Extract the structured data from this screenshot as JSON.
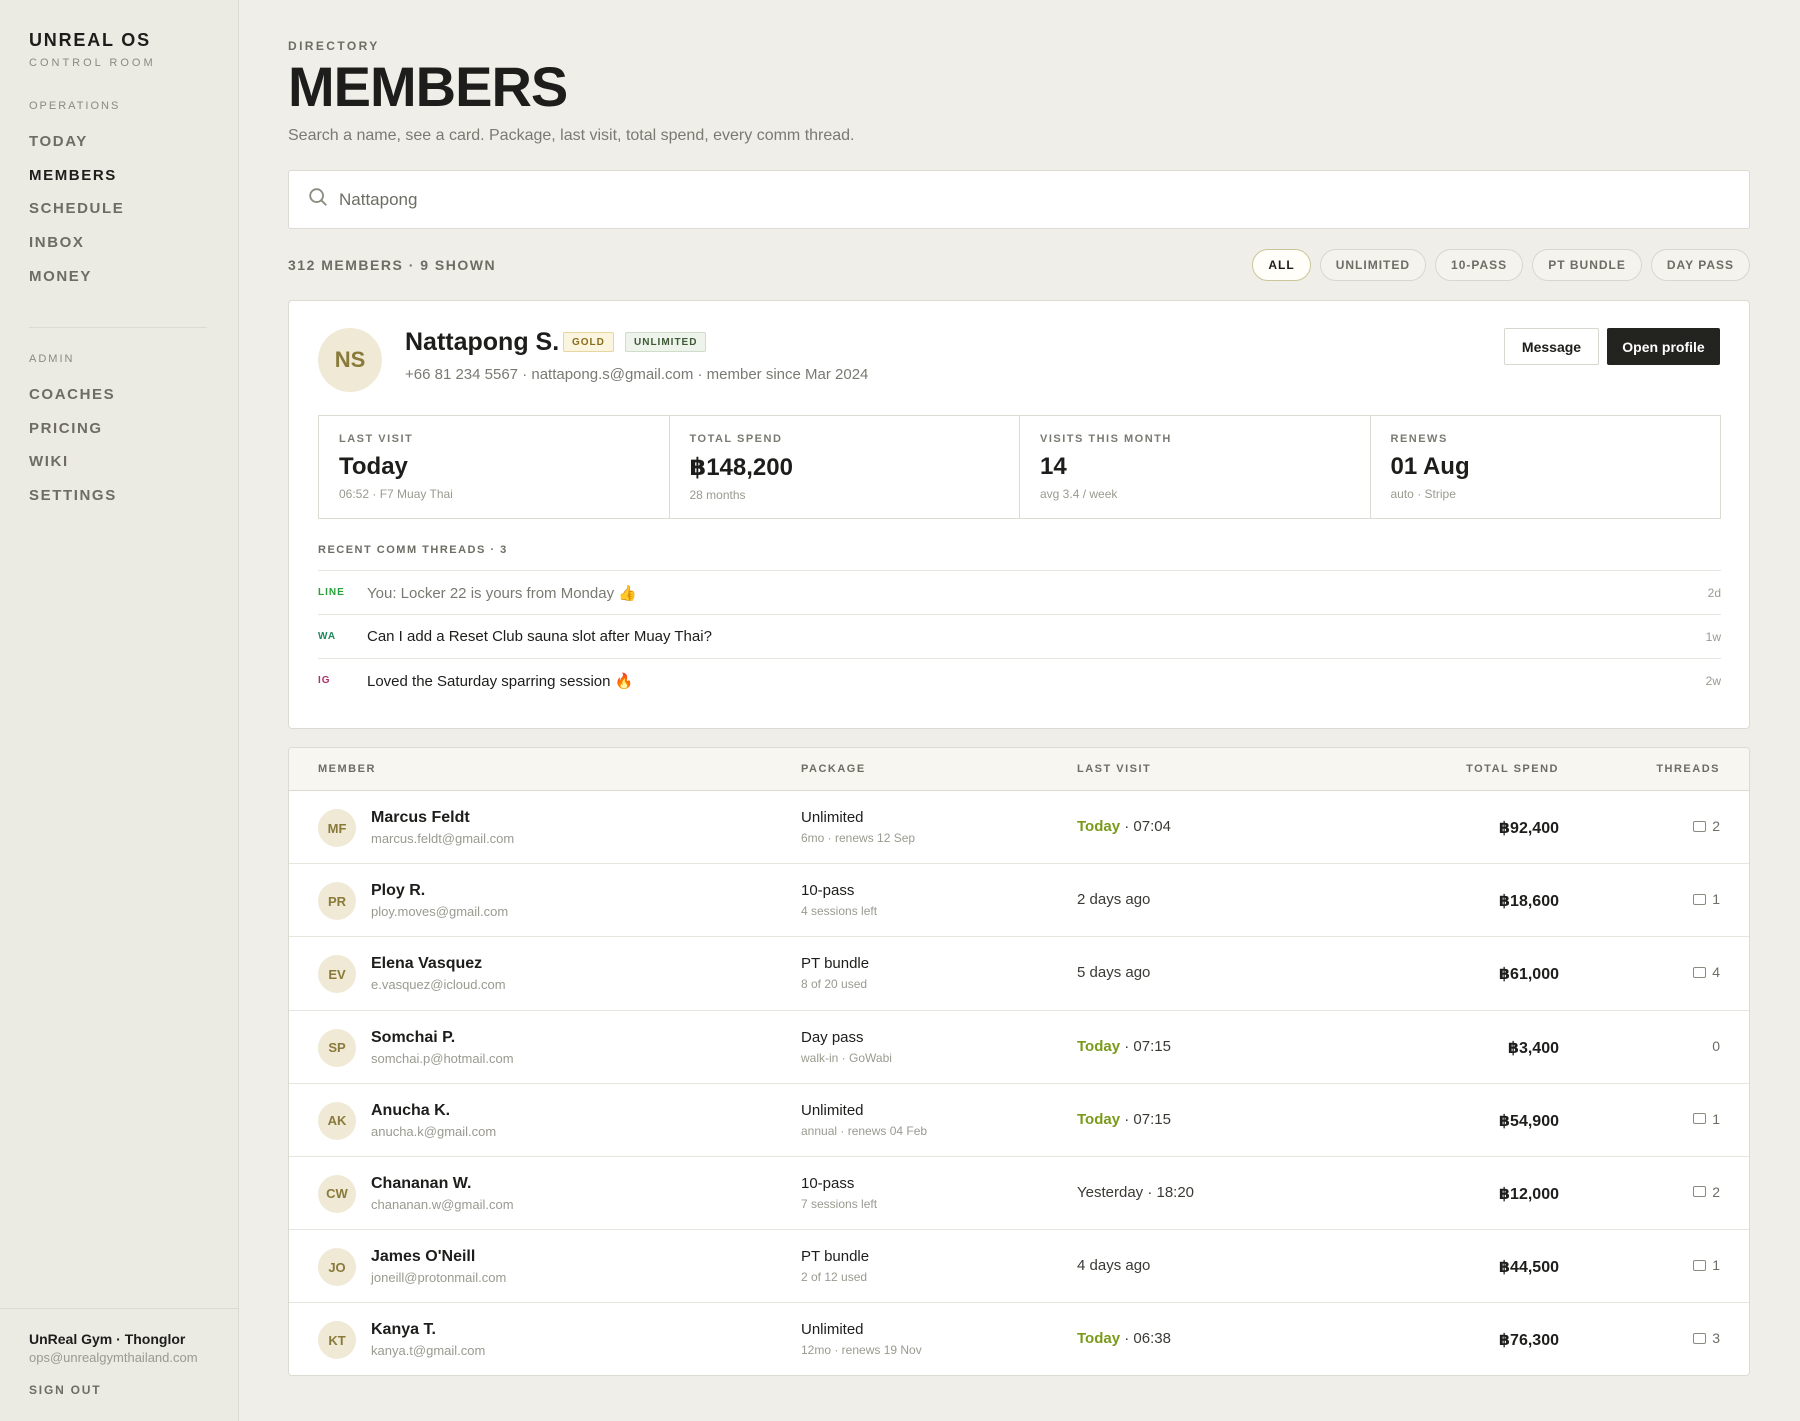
{
  "sidebar": {
    "brand": "UNREAL OS",
    "brand_sub": "CONTROL ROOM",
    "operations_heading": "OPERATIONS",
    "operations": [
      "TODAY",
      "MEMBERS",
      "SCHEDULE",
      "INBOX",
      "MONEY"
    ],
    "admin_heading": "ADMIN",
    "admin": [
      "COACHES",
      "PRICING",
      "WIKI",
      "SETTINGS"
    ],
    "footer": {
      "gym": "UnReal Gym · Thonglor",
      "email": "ops@unrealgymthailand.com",
      "sign_out": "SIGN OUT"
    }
  },
  "header": {
    "eyebrow": "DIRECTORY",
    "title": "MEMBERS",
    "subtitle": "Search a name, see a card. Package, last visit, total spend, every comm thread."
  },
  "search": {
    "value": "Nattapong",
    "placeholder": ""
  },
  "count": "312 MEMBERS · 9 SHOWN",
  "filters": [
    "ALL",
    "UNLIMITED",
    "10-PASS",
    "PT BUNDLE",
    "DAY PASS"
  ],
  "profile": {
    "initials": "NS",
    "name": "Nattapong S.",
    "badge_gold": "GOLD",
    "badge_package": "UNLIMITED",
    "meta": "+66 81 234 5567 · nattapong.s@gmail.com · member since Mar 2024",
    "message_label": "Message",
    "open_label": "Open profile",
    "stats": [
      {
        "label": "LAST VISIT",
        "value": "Today",
        "sub": "06:52 · F7 Muay Thai"
      },
      {
        "label": "TOTAL SPEND",
        "value": "฿148,200",
        "sub": "28 months"
      },
      {
        "label": "VISITS THIS MONTH",
        "value": "14",
        "sub": "avg 3.4 / week"
      },
      {
        "label": "RENEWS",
        "value": "01 Aug",
        "sub": "auto · Stripe"
      }
    ],
    "threads_heading": "RECENT COMM THREADS · 3",
    "threads": [
      {
        "channel": "LINE",
        "text": "You: Locker 22 is yours from Monday 👍",
        "time": "2d"
      },
      {
        "channel": "WA",
        "text": "Can I add a Reset Club sauna slot after Muay Thai?",
        "time": "1w"
      },
      {
        "channel": "IG",
        "text": "Loved the Saturday sparring session 🔥",
        "time": "2w"
      }
    ]
  },
  "table": {
    "columns": {
      "member": "MEMBER",
      "package": "PACKAGE",
      "last_visit": "LAST VISIT",
      "total_spend": "TOTAL SPEND",
      "threads": "THREADS"
    },
    "rows": [
      {
        "initials": "MF",
        "name": "Marcus Feldt",
        "email": "marcus.feldt@gmail.com",
        "package": "Unlimited",
        "package_sub": "6mo · renews 12 Sep",
        "visit_today": "Today",
        "visit": " · 07:04",
        "spend": "฿92,400",
        "threads": "2"
      },
      {
        "initials": "PR",
        "name": "Ploy R.",
        "email": "ploy.moves@gmail.com",
        "package": "10-pass",
        "package_sub": "4 sessions left",
        "visit_today": "",
        "visit": "2 days ago",
        "spend": "฿18,600",
        "threads": "1"
      },
      {
        "initials": "EV",
        "name": "Elena Vasquez",
        "email": "e.vasquez@icloud.com",
        "package": "PT bundle",
        "package_sub": "8 of 20 used",
        "visit_today": "",
        "visit": "5 days ago",
        "spend": "฿61,000",
        "threads": "4"
      },
      {
        "initials": "SP",
        "name": "Somchai P.",
        "email": "somchai.p@hotmail.com",
        "package": "Day pass",
        "package_sub": "walk-in · GoWabi",
        "visit_today": "Today",
        "visit": " · 07:15",
        "spend": "฿3,400",
        "threads": "0"
      },
      {
        "initials": "AK",
        "name": "Anucha K.",
        "email": "anucha.k@gmail.com",
        "package": "Unlimited",
        "package_sub": "annual · renews 04 Feb",
        "visit_today": "Today",
        "visit": " · 07:15",
        "spend": "฿54,900",
        "threads": "1"
      },
      {
        "initials": "CW",
        "name": "Chananan W.",
        "email": "chananan.w@gmail.com",
        "package": "10-pass",
        "package_sub": "7 sessions left",
        "visit_today": "",
        "visit": "Yesterday · 18:20",
        "spend": "฿12,000",
        "threads": "2"
      },
      {
        "initials": "JO",
        "name": "James O'Neill",
        "email": "joneill@protonmail.com",
        "package": "PT bundle",
        "package_sub": "2 of 12 used",
        "visit_today": "",
        "visit": "4 days ago",
        "spend": "฿44,500",
        "threads": "1"
      },
      {
        "initials": "KT",
        "name": "Kanya T.",
        "email": "kanya.t@gmail.com",
        "package": "Unlimited",
        "package_sub": "12mo · renews 19 Nov",
        "visit_today": "Today",
        "visit": " · 06:38",
        "spend": "฿76,300",
        "threads": "3"
      }
    ]
  }
}
